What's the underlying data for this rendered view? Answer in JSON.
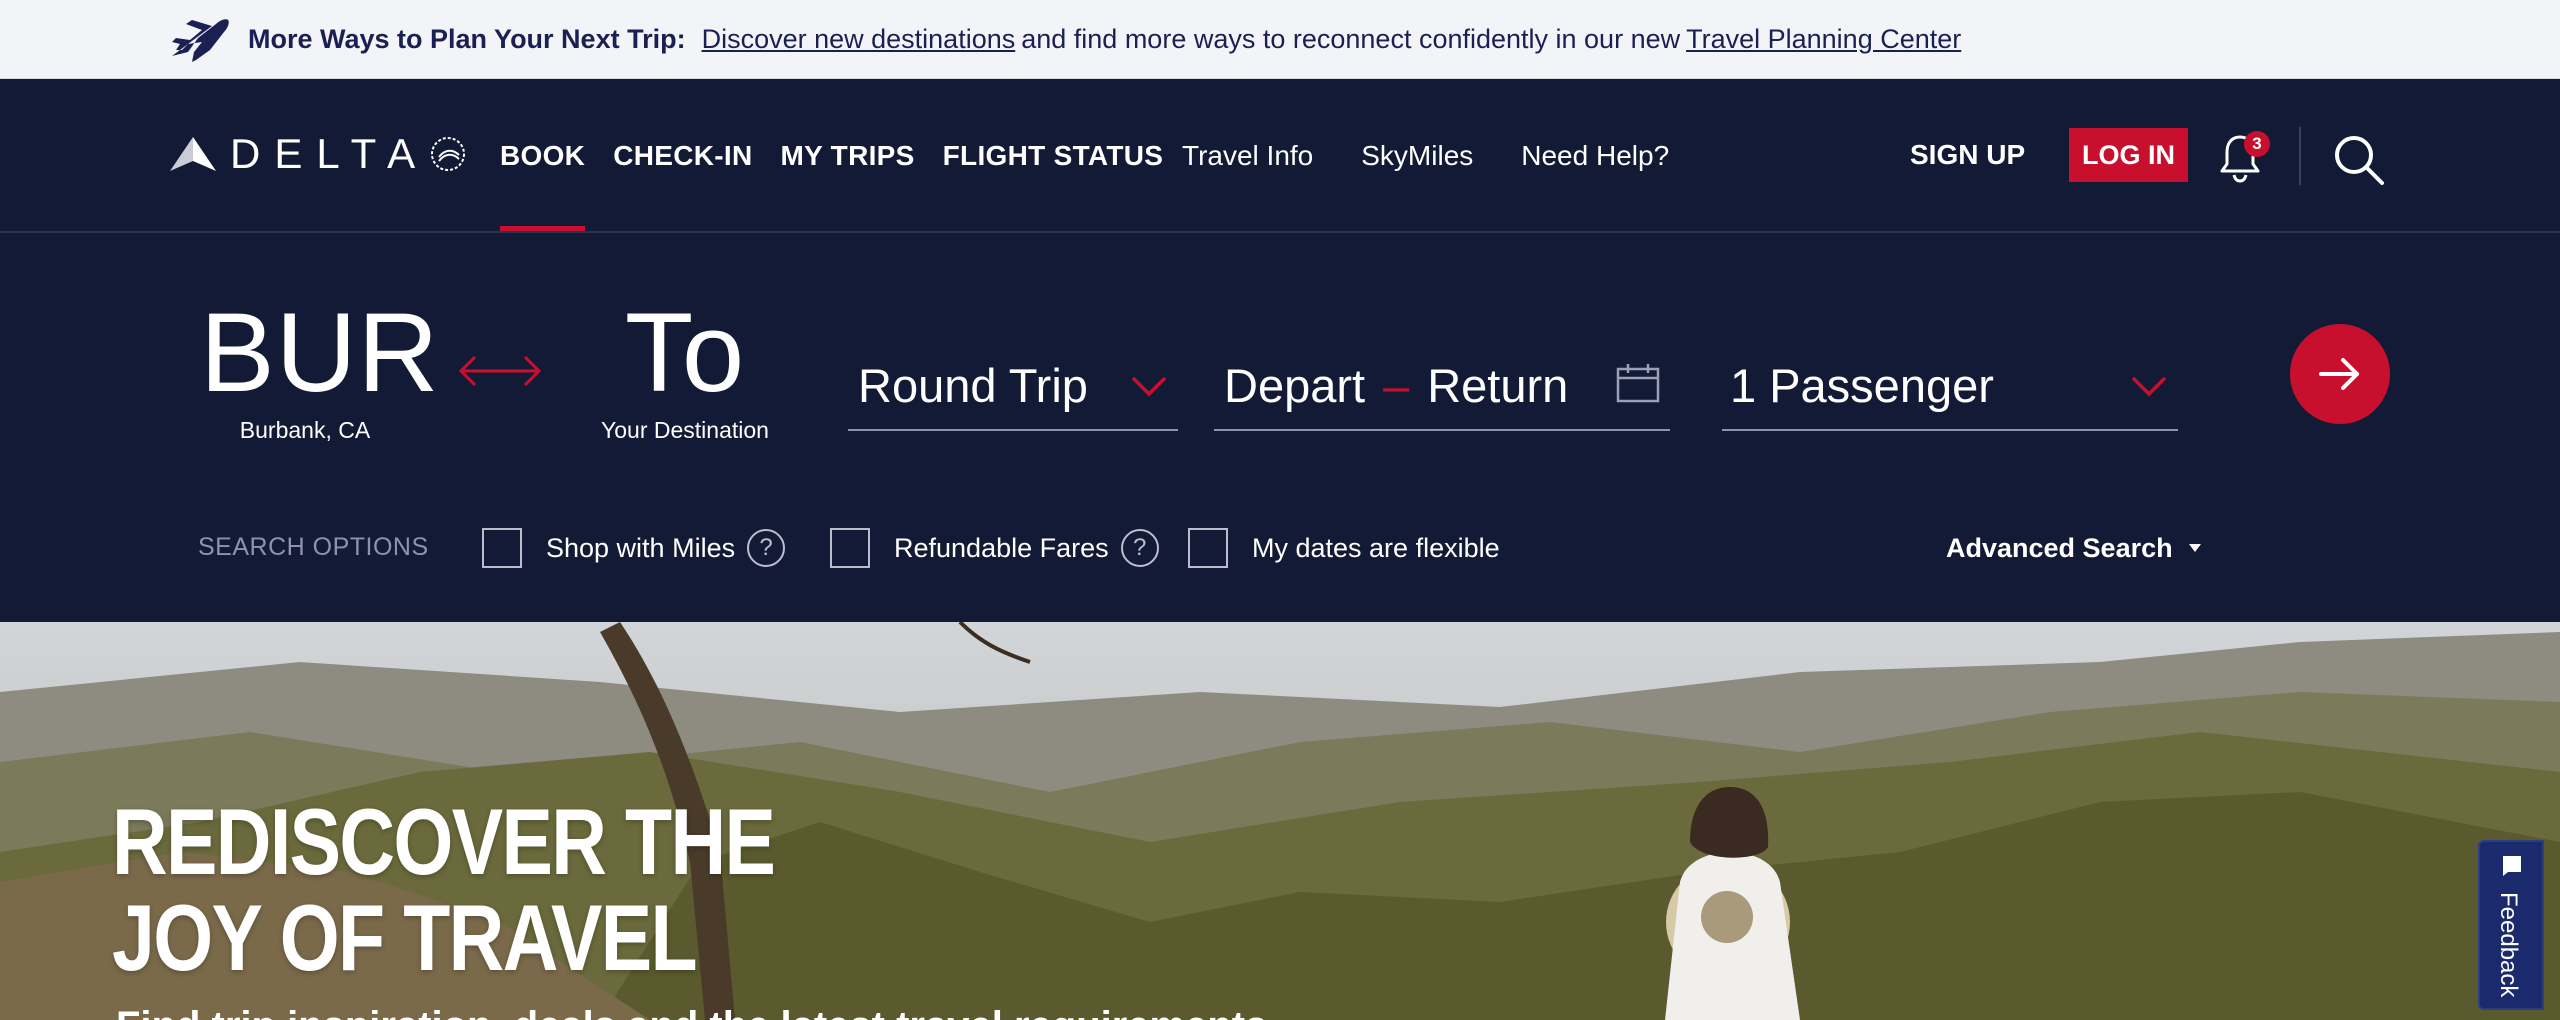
{
  "banner": {
    "lead": "More Ways to Plan Your Next Trip:",
    "link1": "Discover new destinations",
    "middle": "and find more ways to reconnect confidently in our new",
    "link2": "Travel Planning Center",
    "icon": "airplane-icon"
  },
  "nav": {
    "logo_text": "DELTA",
    "primary": [
      {
        "label": "BOOK",
        "active": true
      },
      {
        "label": "CHECK-IN"
      },
      {
        "label": "MY TRIPS"
      },
      {
        "label": "FLIGHT STATUS"
      }
    ],
    "secondary": [
      {
        "label": "Travel Info"
      },
      {
        "label": "SkyMiles"
      },
      {
        "label": "Need Help?"
      }
    ],
    "signup": "SIGN UP",
    "login": "LOG IN",
    "notifications": "3"
  },
  "booking": {
    "from_code": "BUR",
    "from_city": "Burbank, CA",
    "to_code": "To",
    "to_city": "Your Destination",
    "trip_type": "Round Trip",
    "depart": "Depart",
    "dash": "–",
    "return": "Return",
    "passengers": "1 Passenger",
    "search_options_label": "SEARCH OPTIONS",
    "options": [
      {
        "label": "Shop with Miles",
        "help": "?"
      },
      {
        "label": "Refundable Fares",
        "help": "?"
      },
      {
        "label": "My dates are flexible"
      }
    ],
    "advanced": "Advanced Search"
  },
  "hero": {
    "title_line1": "REDISCOVER THE",
    "title_line2": "JOY OF TRAVEL",
    "subtitle": "Find trip inspiration, deals and the latest travel requirements"
  },
  "feedback": "Feedback",
  "colors": {
    "brand_red": "#c8102e",
    "navy": "#131a35"
  }
}
